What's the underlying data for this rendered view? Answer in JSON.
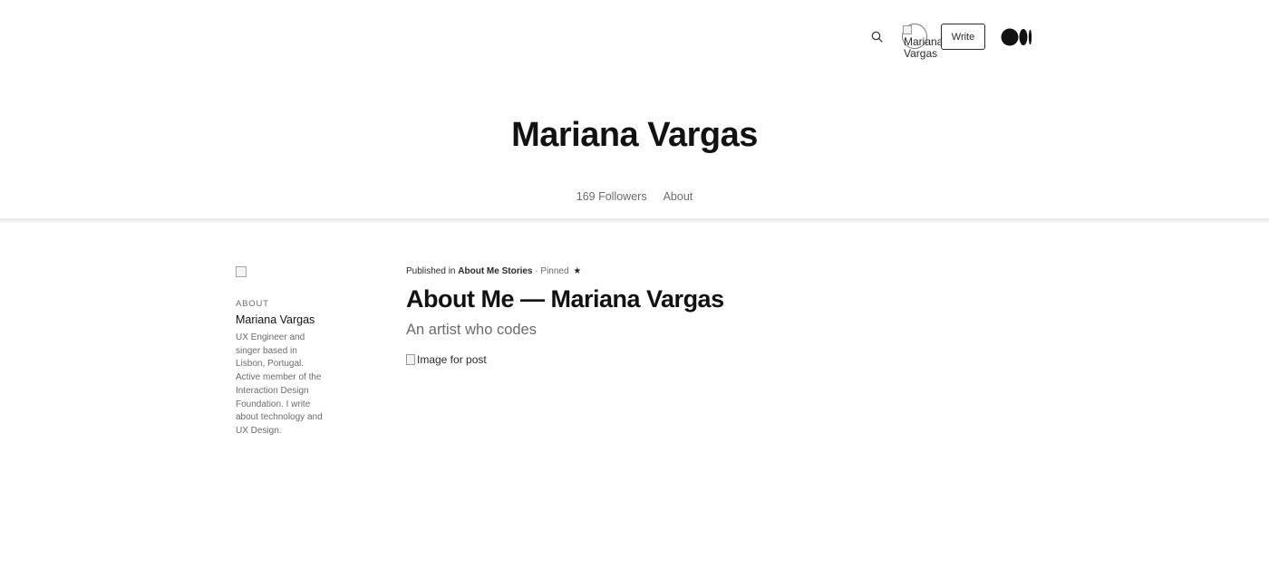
{
  "nav": {
    "search_icon": "magnifier",
    "avatar_alt": "Mariana Vargas",
    "write_label": "Write",
    "logo_icon": "medium-logo"
  },
  "profile": {
    "name": "Mariana Vargas",
    "followers": "169 Followers",
    "about_tab": "About"
  },
  "sidebar": {
    "heading": "ABOUT",
    "name": "Mariana Vargas",
    "bio": "UX Engineer and singer based in Lisbon, Portugal. Active member of the Interaction Design Foundation. I write about technology and UX Design."
  },
  "post": {
    "published_in_label": "Published in",
    "publication": "About Me Stories",
    "separator": "·",
    "pinned": "Pinned",
    "star": "★",
    "title": "About Me — Mariana Vargas",
    "subtitle": "An artist who codes",
    "image_alt": "Image for post"
  },
  "colors": {
    "text": "#292929",
    "heading": "#121212",
    "muted": "#6b6b6b",
    "background": "#ffffff"
  }
}
